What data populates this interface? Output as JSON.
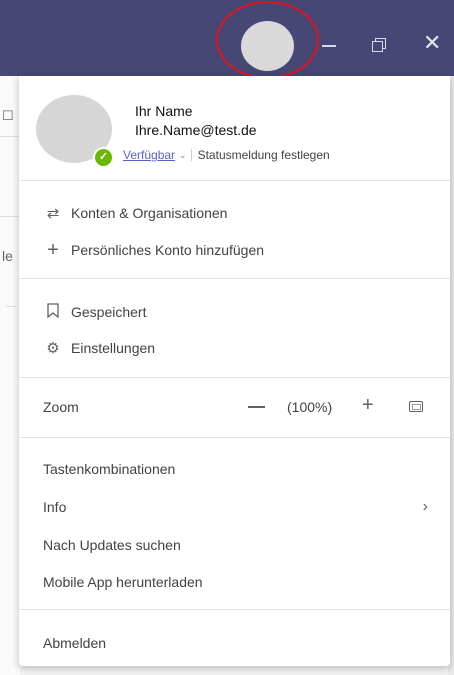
{
  "profile": {
    "name": "Ihr Name",
    "email": "Ihre.Name@test.de",
    "status": "Verfügbar",
    "status_message": "Statusmeldung festlegen"
  },
  "accounts": [
    {
      "icon": "switch-arrows-icon",
      "label": "Konten & Organisationen"
    },
    {
      "icon": "plus-icon",
      "label": "Persönliches Konto hinzufügen"
    }
  ],
  "tools": [
    {
      "icon": "bookmark-icon",
      "label": "Gespeichert"
    },
    {
      "icon": "gear-icon",
      "label": "Einstellungen"
    }
  ],
  "zoom": {
    "label": "Zoom",
    "value": "(100%)"
  },
  "help": [
    {
      "label": "Tastenkombinationen"
    },
    {
      "label": "Info",
      "has_submenu": true
    },
    {
      "label": "Nach Updates suchen"
    },
    {
      "label": "Mobile App herunterladen"
    }
  ],
  "signout": {
    "label": "Abmelden"
  },
  "colors": {
    "titlebar": "#464775",
    "presence": "#6bb700",
    "link": "#5b5fc7",
    "highlight": "#e0141c"
  }
}
